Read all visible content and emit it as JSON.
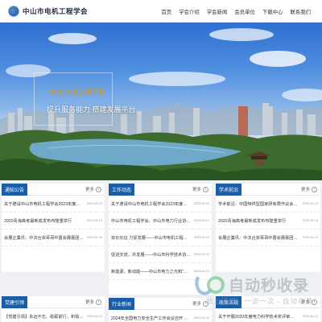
{
  "header": {
    "logo_text": "中山市电机工程学会",
    "nav": [
      "首页",
      "学会介绍",
      "学会新闻",
      "会员单位",
      "下载中心",
      "联系我们"
    ]
  },
  "hero": {
    "title": "中山市电机工程学会",
    "slogan": "提升服务能力 搭建发展平台"
  },
  "panels": {
    "notice": {
      "tag": "通知公告",
      "more": "更多",
      "items": [
        {
          "title": "关于邀请中山市电机工程学会2023年度会費…",
          "date": "2023-08-15"
        },
        {
          "title": "2020青海高考最新成发布布隆重举行",
          "date": "2023-06-13"
        },
        {
          "title": "会展企業讯：中法合资哥哥中晋会展嘉团正…",
          "date": "2023-05-05"
        }
      ]
    },
    "work": {
      "tag": "工作动态",
      "more": "更多",
      "items": [
        {
          "title": "关于邀请中山市电机工程学会2023年度会费…",
          "date": "2023-08-15"
        },
        {
          "title": "中山市电机工程学会、中山市电力行业协会…",
          "date": "2023-06-14"
        },
        {
          "title": "双长长征 力促发展——中山市电机工程学会…",
          "date": "2023-06-13"
        },
        {
          "title": "促进交流，共发展——中山市科学技术协会一…",
          "date": "2023-06-13"
        },
        {
          "title": "新能源，新动能——中山市电力之光和“电学…",
          "date": "2023-06-13"
        }
      ]
    },
    "academic": {
      "tag": "学术前沿",
      "more": "更多",
      "items": [
        {
          "title": "学术前沿：中国特供型国家研有限作议会…",
          "date": "2023-06-13"
        },
        {
          "title": "2020青海高考最新成发布布隆重举行",
          "date": "2023-06-13"
        },
        {
          "title": "会展企業讯：中法合资哥哥中晋会展嘉团正…",
          "date": "2023-05-13"
        }
      ]
    },
    "party": {
      "tag": "党建引领",
      "more": "更多",
      "items": [
        {
          "title": "【党建引领】永远不忘、砥砺前行，积极建设…",
          "date": "2023-06-13"
        }
      ]
    },
    "industry": {
      "tag": "行业新闻",
      "more": "更多",
      "items": [
        {
          "title": "2024年全国电力安全生产工作会议召开 国…",
          "date": "2023-06-13"
        }
      ]
    },
    "policy": {
      "tag": "政策法规",
      "more": "更多",
      "items": [
        {
          "title": "关于开展2020年度电力科学技术奖评审…",
          "date": "2023-06-13"
        }
      ]
    }
  },
  "watermark": {
    "big": "自动秒收录",
    "small": "放上链接，一访一次→自动收录"
  }
}
